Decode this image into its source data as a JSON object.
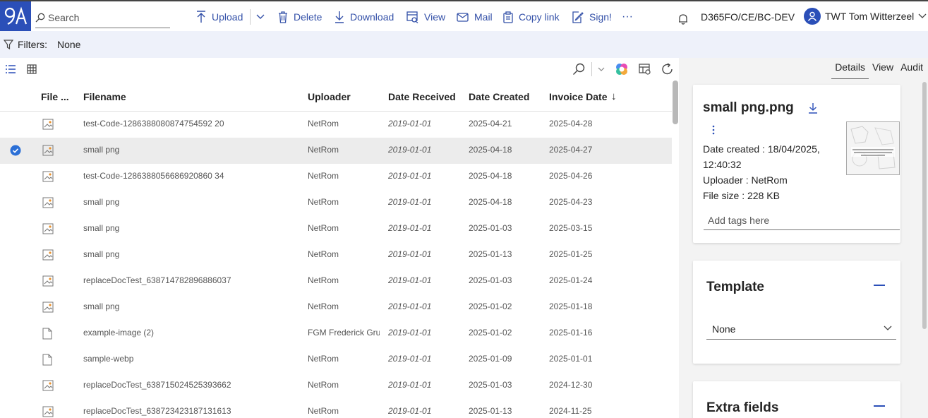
{
  "topbar": {
    "search_placeholder": "Search",
    "actions": {
      "upload": "Upload",
      "delete": "Delete",
      "download": "Download",
      "view": "View",
      "mail": "Mail",
      "copy_link": "Copy link",
      "sign": "Sign!",
      "more": "···"
    },
    "environment": "D365FO/CE/BC-DEV",
    "user": "TWT Tom Witterzeel"
  },
  "filters": {
    "label": "Filters:",
    "value": "None"
  },
  "table": {
    "columns": {
      "file_type": "File ...",
      "filename": "Filename",
      "uploader": "Uploader",
      "date_received": "Date Received",
      "date_created": "Date Created",
      "invoice_date": "Invoice Date"
    },
    "sort_arrow": "↓",
    "rows": [
      {
        "filename": "test-Code-1286388080874754592 20",
        "uploader": "NetRom",
        "received": "2019-01-01",
        "created": "2025-04-21",
        "invoice": "2025-04-28",
        "icon": "image"
      },
      {
        "filename": "small png",
        "uploader": "NetRom",
        "received": "2019-01-01",
        "created": "2025-04-18",
        "invoice": "2025-04-27",
        "icon": "image"
      },
      {
        "filename": "test-Code-1286388056686920860 34",
        "uploader": "NetRom",
        "received": "2019-01-01",
        "created": "2025-04-18",
        "invoice": "2025-04-26",
        "icon": "image"
      },
      {
        "filename": "small png",
        "uploader": "NetRom",
        "received": "2019-01-01",
        "created": "2025-04-18",
        "invoice": "2025-04-23",
        "icon": "image"
      },
      {
        "filename": "small png",
        "uploader": "NetRom",
        "received": "2019-01-01",
        "created": "2025-01-03",
        "invoice": "2025-03-15",
        "icon": "image"
      },
      {
        "filename": "small png",
        "uploader": "NetRom",
        "received": "2019-01-01",
        "created": "2025-01-13",
        "invoice": "2025-01-25",
        "icon": "image"
      },
      {
        "filename": "replaceDocTest_638714782896886037",
        "uploader": "NetRom",
        "received": "2019-01-01",
        "created": "2025-01-03",
        "invoice": "2025-01-24",
        "icon": "image"
      },
      {
        "filename": "small png",
        "uploader": "NetRom",
        "received": "2019-01-01",
        "created": "2025-01-02",
        "invoice": "2025-01-18",
        "icon": "image"
      },
      {
        "filename": "example-image (2)",
        "uploader": "FGM Frederick Grun",
        "received": "2019-01-01",
        "created": "2025-01-02",
        "invoice": "2025-01-16",
        "icon": "file"
      },
      {
        "filename": "sample-webp",
        "uploader": "NetRom",
        "received": "2019-01-01",
        "created": "2025-01-09",
        "invoice": "2025-01-01",
        "icon": "file"
      },
      {
        "filename": "replaceDocTest_638715024525393662",
        "uploader": "NetRom",
        "received": "2019-01-01",
        "created": "2025-01-03",
        "invoice": "2024-12-30",
        "icon": "image"
      },
      {
        "filename": "replaceDocTest_638723423187131613",
        "uploader": "NetRom",
        "received": "2019-01-01",
        "created": "2025-01-13",
        "invoice": "2024-11-25",
        "icon": "image"
      }
    ]
  },
  "panel": {
    "tabs": [
      "Details",
      "View",
      "Audit"
    ],
    "file_name": "small png.png",
    "date_created": "Date created : 18/04/2025,",
    "date_created_time": "12:40:32",
    "uploader": "Uploader : NetRom",
    "file_size": "File size : 228 KB",
    "tags_placeholder": "Add tags here",
    "template_title": "Template",
    "template_value": "None",
    "extra_fields_title": "Extra fields"
  },
  "colors": {
    "accent": "#2b4fb8",
    "filterbar": "#eef1fa",
    "panel": "#f3f3f3"
  }
}
